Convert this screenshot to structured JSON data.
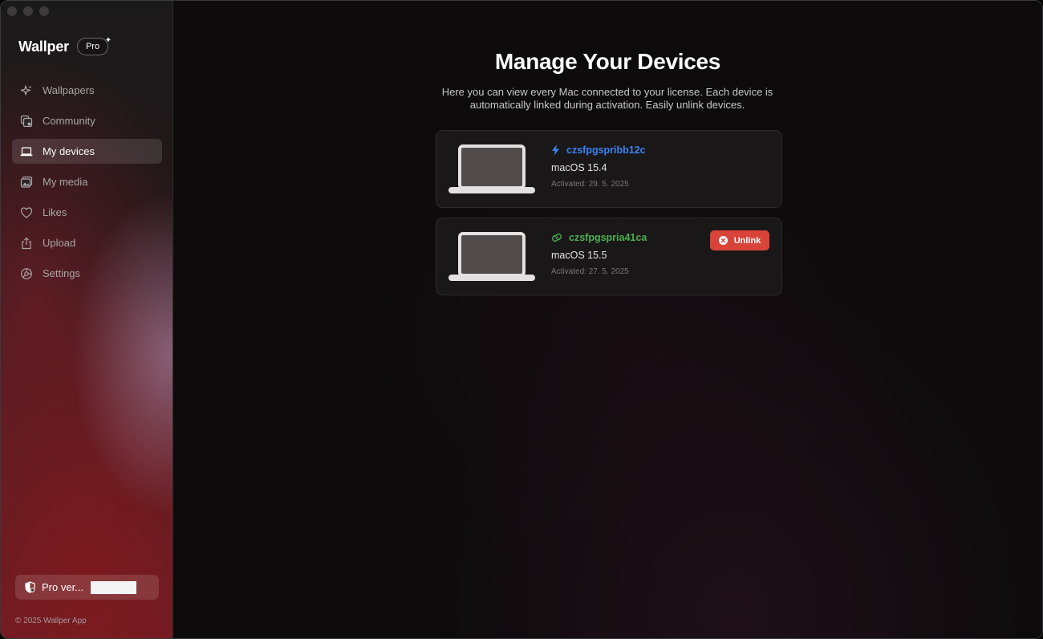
{
  "app": {
    "name": "Wallper",
    "badge": "Pro",
    "copyright": "© 2025 Wallper App"
  },
  "sidebar": {
    "items": [
      {
        "label": "Wallpapers",
        "icon": "sparkles-icon"
      },
      {
        "label": "Community",
        "icon": "community-icon"
      },
      {
        "label": "My devices",
        "icon": "laptop-icon",
        "active": true
      },
      {
        "label": "My media",
        "icon": "photos-icon"
      },
      {
        "label": "Likes",
        "icon": "heart-icon"
      },
      {
        "label": "Upload",
        "icon": "upload-icon"
      },
      {
        "label": "Settings",
        "icon": "gear-icon"
      }
    ],
    "pro_status": {
      "label": "Pro ver...",
      "icon": "shield-icon"
    }
  },
  "main": {
    "title": "Manage Your Devices",
    "subtitle": "Here you can view every Mac connected to your license. Each device is automatically linked during activation. Easily unlink devices.",
    "devices": [
      {
        "name": "czsfpgspribb12c",
        "os": "macOS 15.4",
        "activated": "Activated: 29. 5. 2025",
        "icon": "bolt-icon",
        "name_color": "#3b82f6",
        "current": true
      },
      {
        "name": "czsfpgspria41ca",
        "os": "macOS 15.5",
        "activated": "Activated: 27. 5. 2025",
        "icon": "link-icon",
        "name_color": "#4caf50",
        "unlink_label": "Unlink"
      }
    ]
  },
  "colors": {
    "accent_red": "#d8443a",
    "current_blue": "#3b82f6",
    "linked_green": "#4caf50"
  }
}
